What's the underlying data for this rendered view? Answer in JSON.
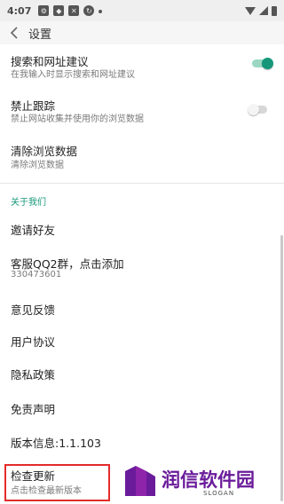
{
  "status_bar": {
    "time": "4:07"
  },
  "toolbar": {
    "title": "设置"
  },
  "settings": {
    "search_suggest": {
      "title": "搜索和网址建议",
      "subtitle": "在我输入时显示搜索和网址建议",
      "enabled": true
    },
    "do_not_track": {
      "title": "禁止跟踪",
      "subtitle": "禁止网站收集并使用你的浏览数据",
      "enabled": false
    },
    "clear_data": {
      "title": "清除浏览数据",
      "subtitle": "清除浏览数据"
    }
  },
  "about": {
    "header": "关于我们",
    "invite": "邀请好友",
    "qq_group": {
      "title": "客服QQ2群，点击添加",
      "subtitle": "330473601"
    },
    "feedback": "意见反馈",
    "user_agreement": "用户协议",
    "privacy": "隐私政策",
    "disclaimer": "免责声明",
    "version": "版本信息:1.1.103",
    "check_update": {
      "title": "检查更新",
      "subtitle": "点击检查最新版本"
    }
  },
  "watermark": {
    "text": "润信软件园",
    "slogan": "SLOGAN"
  },
  "colors": {
    "accent": "#16977a",
    "highlight": "#e32b2b",
    "watermark_purple": "#6a1b9a"
  }
}
